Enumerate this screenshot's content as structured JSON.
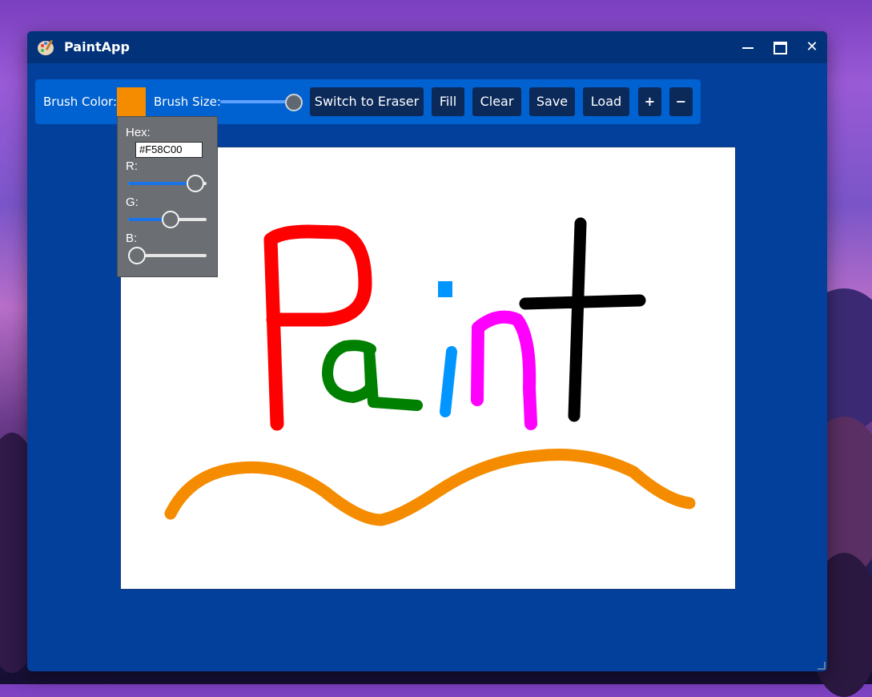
{
  "window": {
    "title": "PaintApp",
    "app_icon": "paint-palette-icon",
    "controls": {
      "minimize_icon": "minimize-icon",
      "maximize_icon": "maximize-icon",
      "close_icon": "close-icon"
    }
  },
  "toolbar": {
    "brush_color_label": "Brush Color:",
    "brush_color": "#F58C00",
    "brush_size_label": "Brush Size:",
    "brush_size_level": 1.0,
    "switch_eraser_label": "Switch to Eraser",
    "fill_label": "Fill",
    "clear_label": "Clear",
    "save_label": "Save",
    "load_label": "Load",
    "plus_label": "+",
    "minus_label": "−"
  },
  "color_picker": {
    "hex_label": "Hex:",
    "hex_value": "#F58C00",
    "r_label": "R:",
    "g_label": "G:",
    "b_label": "B:",
    "r_value": 245,
    "g_value": 140,
    "b_value": 0
  },
  "canvas": {
    "strokes": [
      {
        "name": "letter-P",
        "color": "#FF0000"
      },
      {
        "name": "letter-a",
        "color": "#008000"
      },
      {
        "name": "letter-i",
        "color": "#0095FF"
      },
      {
        "name": "letter-n",
        "color": "#FF00FF"
      },
      {
        "name": "letter-t",
        "color": "#000000"
      },
      {
        "name": "wave",
        "color": "#F58C00"
      }
    ]
  }
}
